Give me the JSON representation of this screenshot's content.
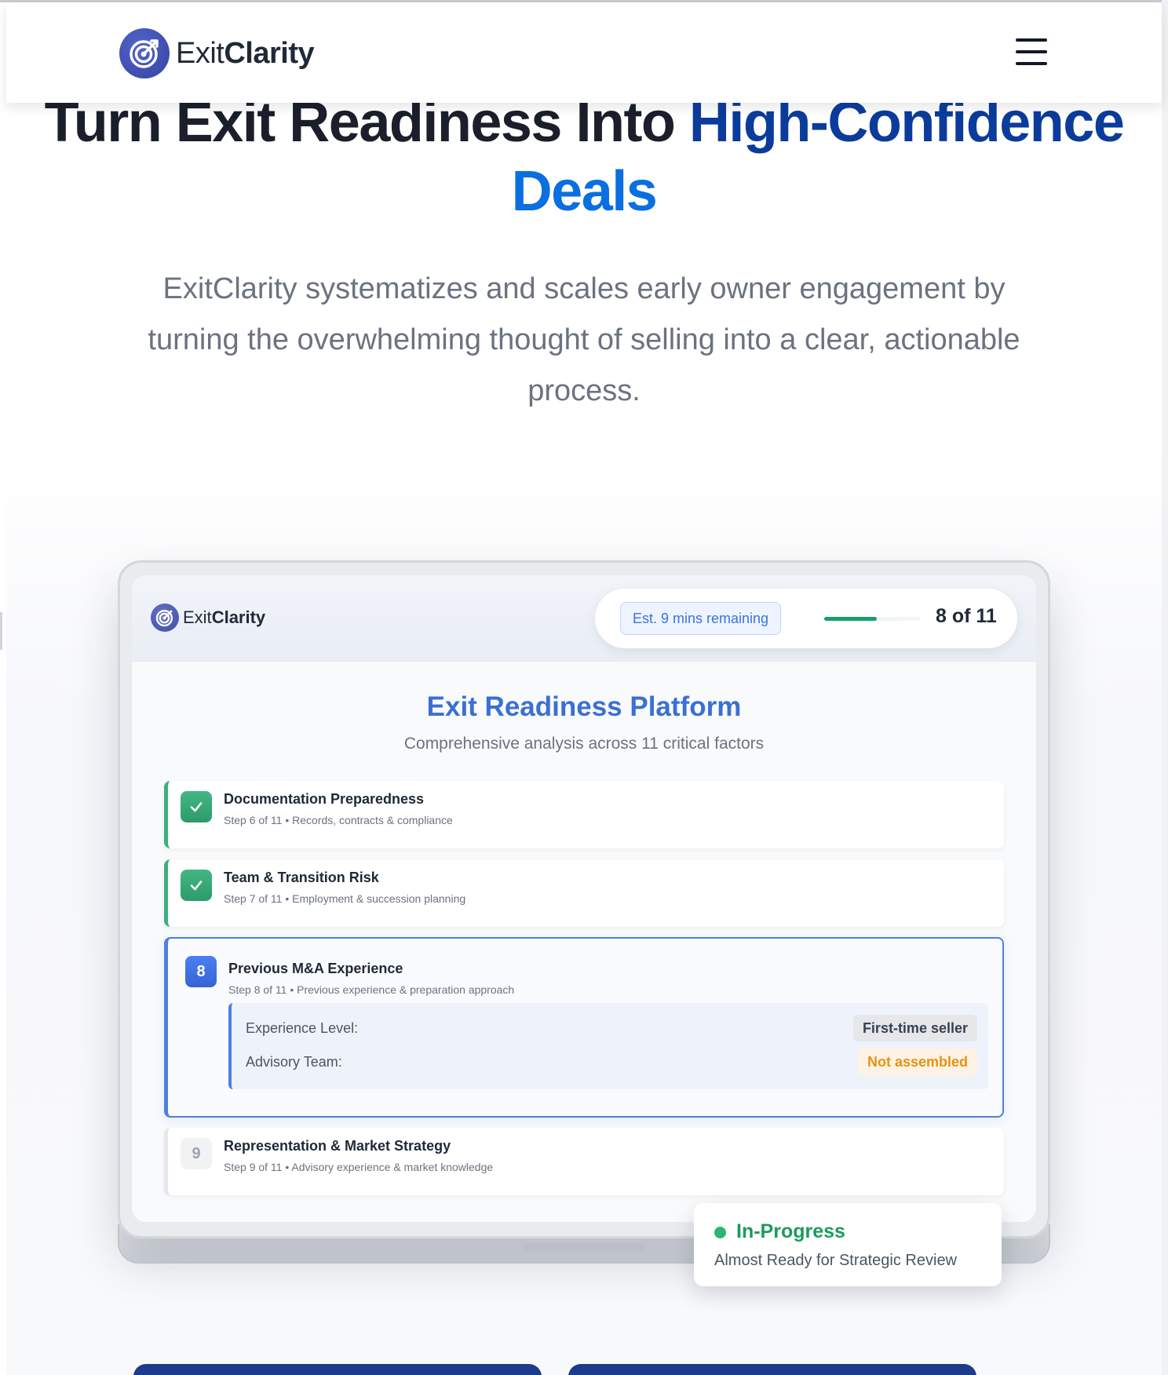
{
  "header": {
    "brand": {
      "name_light": "Exit",
      "name_bold": "Clarity",
      "logo_icon": "target-arrow-icon"
    },
    "menu_icon": "hamburger-menu-icon"
  },
  "hero": {
    "title_dark": "Turn Exit Readiness Into ",
    "title_blue_dark": "High-Confidence",
    "title_blue_light": " Deals",
    "subtitle": "ExitClarity systematizes and scales early owner engagement by turning the overwhelming thought of selling into a clear, actionable process."
  },
  "app": {
    "brand": {
      "name_light": "Exit",
      "name_bold": "Clarity"
    },
    "eta": "Est. 9 mins remaining",
    "progress": {
      "current": 8,
      "total": 11,
      "label": "8 of 11"
    },
    "title": "Exit Readiness Platform",
    "subtitle": "Comprehensive analysis across 11 critical factors",
    "steps": [
      {
        "status": "complete",
        "icon": "checkmark-icon",
        "title": "Documentation Preparedness",
        "meta": "Step 6 of 11 • Records, contracts & compliance"
      },
      {
        "status": "complete",
        "icon": "checkmark-icon",
        "title": "Team & Transition Risk",
        "meta": "Step 7 of 11 • Employment & succession planning"
      },
      {
        "status": "active",
        "number": "8",
        "title": "Previous M&A Experience",
        "meta": "Step 8 of 11 • Previous experience & preparation approach",
        "details": [
          {
            "label": "Experience Level:",
            "value": "First-time seller"
          },
          {
            "label": "Advisory Team:",
            "value": "Not assembled"
          }
        ]
      },
      {
        "status": "pending",
        "number": "9",
        "title": "Representation & Market Strategy",
        "meta": "Step 9 of 11 • Advisory experience & market knowledge"
      }
    ],
    "status_card": {
      "title": "In-Progress",
      "subtitle": "Almost Ready for Strategic Review"
    }
  },
  "colors": {
    "brand_blue": "#3442a4",
    "accent_blue": "#3b6fd4",
    "success_green": "#1a9c5b",
    "warning_orange": "#e59413"
  }
}
